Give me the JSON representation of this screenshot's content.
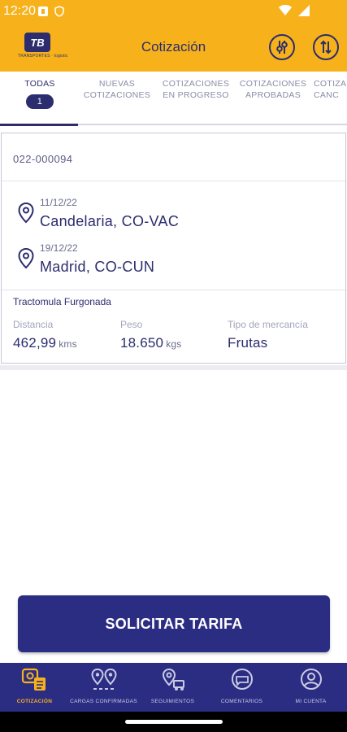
{
  "status_bar": {
    "time": "12:20",
    "icons": [
      "sim-icon",
      "shield-icon",
      "wifi-icon",
      "signal-icon"
    ]
  },
  "header": {
    "logo_text": "TB",
    "logo_subtext": "TRANSPORTES · logistic",
    "title": "Cotización",
    "actions": [
      "filter-icon",
      "sort-icon"
    ]
  },
  "tabs": [
    {
      "label": "TODAS",
      "badge": "1",
      "active": true
    },
    {
      "label": "NUEVAS COTIZACIONES",
      "active": false
    },
    {
      "label": "COTIZACIONES EN PROGRESO",
      "active": false
    },
    {
      "label": "COTIZACIONES APROBADAS",
      "active": false
    },
    {
      "label": "COTIZA CANC",
      "active": false
    }
  ],
  "quote": {
    "id": "022-000094",
    "origin": {
      "date": "11/12/22",
      "city": "Candelaria, CO-VAC"
    },
    "destination": {
      "date": "19/12/22",
      "city": "Madrid, CO-CUN"
    },
    "vehicle": "Tractomula Furgonada",
    "distance": {
      "label": "Distancia",
      "value": "462,99",
      "unit": "kms"
    },
    "weight": {
      "label": "Peso",
      "value": "18.650",
      "unit": "kgs"
    },
    "goods": {
      "label": "Tipo de mercancía",
      "value": "Frutas"
    }
  },
  "cta": {
    "label": "SOLICITAR TARIFA"
  },
  "bottom_nav": [
    {
      "label": "COTIZACIÓN",
      "icon": "quote-icon",
      "active": true
    },
    {
      "label": "CARGAS CONFIRMADAS",
      "icon": "route-pins-icon",
      "active": false
    },
    {
      "label": "SEGUIMIENTOS",
      "icon": "tracking-icon",
      "active": false
    },
    {
      "label": "COMENTARIOS",
      "icon": "chat-icon",
      "active": false
    },
    {
      "label": "MI CUENTA",
      "icon": "account-icon",
      "active": false
    }
  ],
  "colors": {
    "brand_yellow": "#f7b21b",
    "brand_navy": "#2b2d83"
  }
}
